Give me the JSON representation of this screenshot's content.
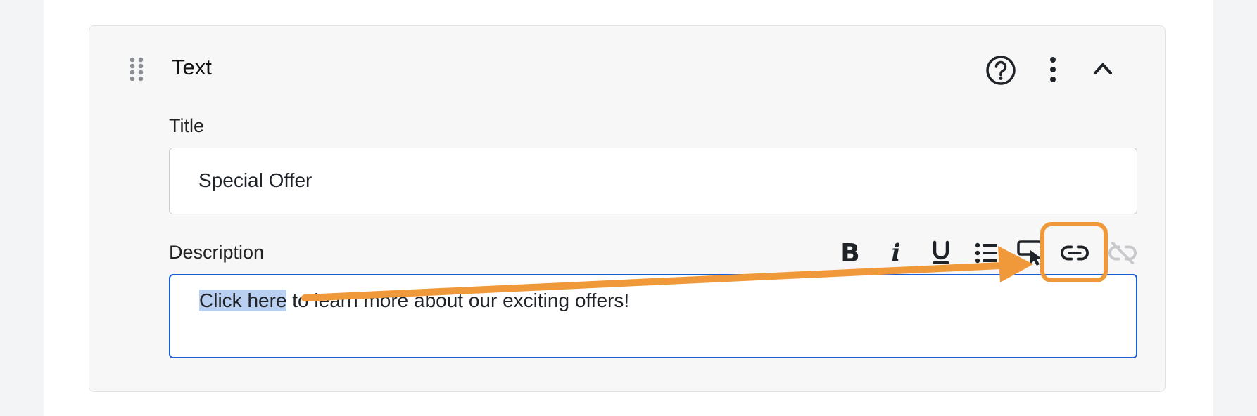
{
  "block": {
    "title": "Text",
    "icons": [
      "drag-handle-icon",
      "help-icon",
      "more-vertical-icon",
      "chevron-up-icon"
    ]
  },
  "fields": {
    "title_label": "Title",
    "title_value": "Special Offer",
    "description_label": "Description",
    "description_selected": "Click here",
    "description_rest": " to learn more about our exciting offers!"
  },
  "toolbar": {
    "bold": "B",
    "italic": "i",
    "buttons": [
      "bold",
      "italic",
      "underline",
      "bulleted-list",
      "cursor-select",
      "link",
      "unlink"
    ]
  },
  "colors": {
    "annotation": "#f0993a",
    "focus_border": "#1a5ed4",
    "selection": "#b9d0f0"
  }
}
